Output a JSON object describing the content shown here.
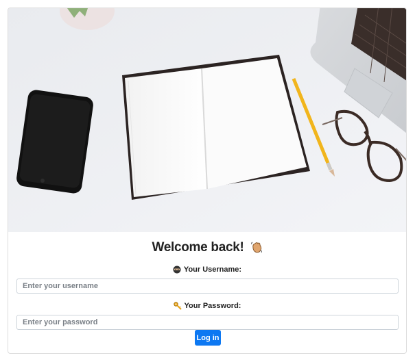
{
  "login": {
    "title": "Welcome back!",
    "title_emoji": "waving-hand-icon",
    "username_label": "Your Username:",
    "username_icon": "ninja-icon",
    "username_placeholder": "Enter your username",
    "username_value": "",
    "password_label": "Your Password:",
    "password_icon": "key-icon",
    "password_placeholder": "Enter your password",
    "password_value": "",
    "submit_label": "Log in"
  },
  "colors": {
    "accent": "#0d78f2",
    "border": "#ccd3da"
  }
}
